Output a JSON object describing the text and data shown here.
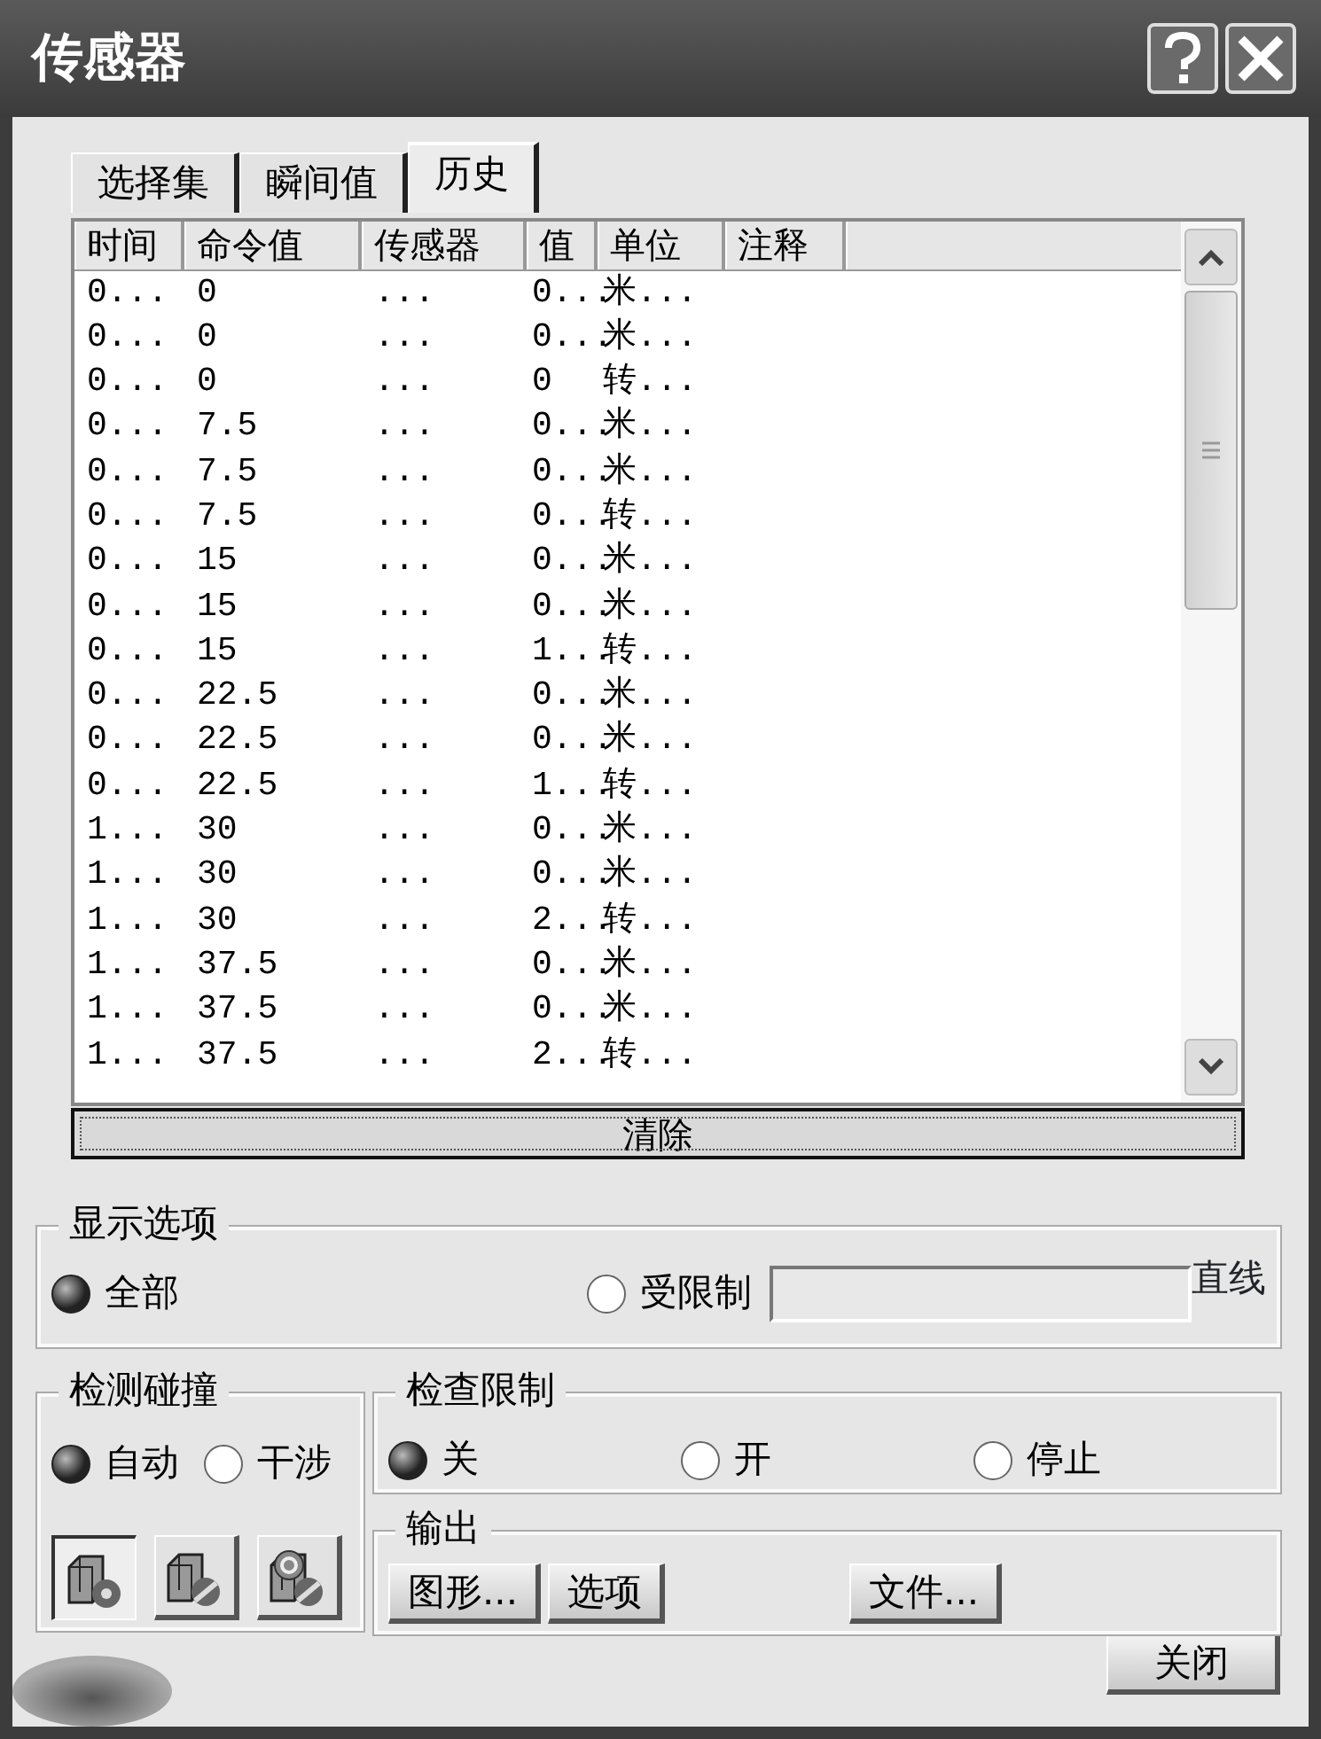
{
  "window": {
    "title": "传感器"
  },
  "tabs": [
    {
      "label": "选择集",
      "selected": false
    },
    {
      "label": "瞬间值",
      "selected": false
    },
    {
      "label": "历史",
      "selected": true
    }
  ],
  "table": {
    "columns": [
      "时间",
      "命令值",
      "传感器",
      "值",
      "单位",
      "注释"
    ],
    "rows": [
      [
        "0...",
        "0",
        "...",
        "0...",
        "米..."
      ],
      [
        "0...",
        "0",
        "...",
        "0...",
        "米..."
      ],
      [
        "0...",
        "0",
        "...",
        "0",
        "转..."
      ],
      [
        "0...",
        "7.5",
        "...",
        "0...",
        "米..."
      ],
      [
        "0...",
        "7.5",
        "...",
        "0...",
        "米..."
      ],
      [
        "0...",
        "7.5",
        "...",
        "0...",
        "转..."
      ],
      [
        "0...",
        "15",
        "...",
        "0...",
        "米..."
      ],
      [
        "0...",
        "15",
        "...",
        "0...",
        "米..."
      ],
      [
        "0...",
        "15",
        "...",
        "1...",
        "转..."
      ],
      [
        "0...",
        "22.5",
        "...",
        "0...",
        "米..."
      ],
      [
        "0...",
        "22.5",
        "...",
        "0...",
        "米..."
      ],
      [
        "0...",
        "22.5",
        "...",
        "1...",
        "转..."
      ],
      [
        "1...",
        "30",
        "...",
        "0...",
        "米..."
      ],
      [
        "1...",
        "30",
        "...",
        "0...",
        "米..."
      ],
      [
        "1...",
        "30",
        "...",
        "2...",
        "转..."
      ],
      [
        "1...",
        "37.5",
        "...",
        "0...",
        "米..."
      ],
      [
        "1...",
        "37.5",
        "...",
        "0...",
        "米..."
      ],
      [
        "1...",
        "37.5",
        "...",
        "2...",
        "转..."
      ]
    ]
  },
  "clear_button": "清除",
  "display_options": {
    "title": "显示选项",
    "options": [
      {
        "label": "全部",
        "selected": true
      },
      {
        "label": "受限制",
        "selected": false
      }
    ],
    "unit_label": "直线"
  },
  "collision": {
    "title": "检测碰撞",
    "options": [
      {
        "label": "自动",
        "selected": true
      },
      {
        "label": "干涉",
        "selected": false
      }
    ],
    "tools": [
      {
        "kind": "dot",
        "selected": true
      },
      {
        "kind": "slash",
        "selected": false
      },
      {
        "kind": "ring",
        "selected": false
      }
    ]
  },
  "check_limits": {
    "title": "检查限制",
    "options": [
      {
        "label": "关",
        "selected": true
      },
      {
        "label": "开",
        "selected": false
      },
      {
        "label": "停止",
        "selected": false
      }
    ]
  },
  "output": {
    "title": "输出",
    "buttons": [
      "图形...",
      "选项",
      "文件..."
    ]
  },
  "close_button": "关闭"
}
